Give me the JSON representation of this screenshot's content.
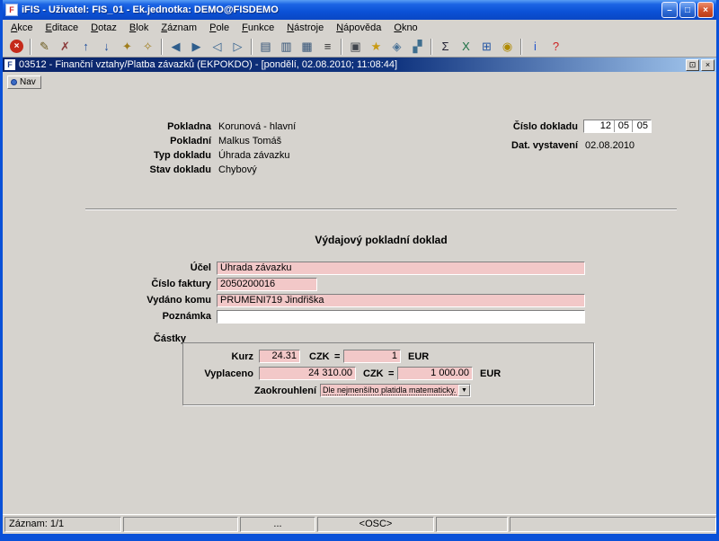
{
  "window": {
    "title": "iFIS - Uživatel: FIS_01 - Ek.jednotka: DEMO@FISDEMO",
    "app_icon_letter": "F",
    "controls": {
      "minimize": "–",
      "maximize": "□",
      "close": "×"
    }
  },
  "menu": {
    "items": [
      "Akce",
      "Editace",
      "Dotaz",
      "Blok",
      "Záznam",
      "Pole",
      "Funkce",
      "Nástroje",
      "Nápověda",
      "Okno"
    ]
  },
  "toolbar": {
    "buttons": [
      {
        "name": "exit",
        "glyph": "×",
        "fg": "#ffffff",
        "exit": true
      },
      {
        "sep": true
      },
      {
        "name": "edit-record",
        "glyph": "✎",
        "fg": "#6B5B1E"
      },
      {
        "name": "clear-record",
        "glyph": "✗",
        "fg": "#8B3A3A"
      },
      {
        "name": "scroll-up",
        "glyph": "↑",
        "fg": "#1F4E9C"
      },
      {
        "name": "scroll-down",
        "glyph": "↓",
        "fg": "#1F4E9C"
      },
      {
        "name": "key",
        "glyph": "✦",
        "fg": "#A07D1C"
      },
      {
        "name": "list-of-values",
        "glyph": "✧",
        "fg": "#A07D1C"
      },
      {
        "sep": true
      },
      {
        "name": "previous-block",
        "glyph": "◀",
        "fg": "#2F5E8C"
      },
      {
        "name": "next-block",
        "glyph": "▶",
        "fg": "#2F5E8C"
      },
      {
        "name": "previous-record",
        "glyph": "◁",
        "fg": "#2F5E8C"
      },
      {
        "name": "next-record",
        "glyph": "▷",
        "fg": "#2F5E8C"
      },
      {
        "sep": true
      },
      {
        "name": "record-list",
        "glyph": "▤",
        "fg": "#2F4F74"
      },
      {
        "name": "multi-record-view",
        "glyph": "▥",
        "fg": "#2F4F74"
      },
      {
        "name": "overview",
        "glyph": "▦",
        "fg": "#2F4F74"
      },
      {
        "name": "row-menu",
        "glyph": "≡",
        "fg": "#333333"
      },
      {
        "sep": true
      },
      {
        "name": "print",
        "glyph": "▣",
        "fg": "#40454D"
      },
      {
        "name": "favorites",
        "glyph": "★",
        "fg": "#C99A12"
      },
      {
        "name": "attachments",
        "glyph": "◈",
        "fg": "#4A7296"
      },
      {
        "name": "chart",
        "glyph": "▞",
        "fg": "#3E6E8E"
      },
      {
        "sep": true
      },
      {
        "name": "sum",
        "glyph": "Σ",
        "fg": "#222233"
      },
      {
        "name": "export-excel",
        "glyph": "X",
        "fg": "#1E7145"
      },
      {
        "name": "window-grid",
        "glyph": "⊞",
        "fg": "#2456A4"
      },
      {
        "name": "lock",
        "glyph": "◉",
        "fg": "#B08A00"
      },
      {
        "sep": true
      },
      {
        "name": "info",
        "glyph": "i",
        "fg": "#2255CC"
      },
      {
        "name": "help",
        "glyph": "?",
        "fg": "#CC2222"
      }
    ]
  },
  "mdi": {
    "title": "03512 - Finanční vztahy/Platba závazků (EKPOKDO) - [pondělí, 02.08.2010; 11:08:44]",
    "icon_letter": "F",
    "controls": {
      "restore": "⊡",
      "close": "×"
    }
  },
  "nav": {
    "label": "Nav"
  },
  "header": {
    "rows": [
      {
        "label": "Pokladna",
        "value": "Korunová - hlavní"
      },
      {
        "label": "Pokladní",
        "value": "Malkus Tomáš"
      },
      {
        "label": "Typ dokladu",
        "value": "Úhrada závazku"
      },
      {
        "label": "Stav dokladu",
        "value": "Chybový"
      }
    ],
    "doc_number": {
      "label": "Číslo dokladu",
      "parts": [
        "12",
        "05",
        "05"
      ]
    },
    "date_issued": {
      "label": "Dat. vystavení",
      "value": "02.08.2010"
    }
  },
  "form": {
    "title": "Výdajový pokladní doklad",
    "fields": [
      {
        "label": "Účel",
        "value": "Úhrada závazku"
      },
      {
        "label": "Číslo faktury",
        "value": "2050200016"
      },
      {
        "label": "Vydáno komu",
        "value": "PRUMENI719 Jindřiška"
      },
      {
        "label": "Poznámka",
        "value": ""
      }
    ],
    "amounts": {
      "label": "Částky",
      "rows": [
        {
          "label": "Kurz",
          "amount_czk": "24.31",
          "currency_left": "CZK",
          "equals": "=",
          "amount_eur": "1",
          "currency_right": "EUR"
        },
        {
          "label": "Vyplaceno",
          "amount_czk": "24 310.00",
          "currency_left": "CZK",
          "equals": "=",
          "amount_eur": "1 000.00",
          "currency_right": "EUR"
        }
      ],
      "rounding": {
        "label": "Zaokrouhlení",
        "value": "Dle nejmenšího platidla matematicky...",
        "arrow_glyph": "▼"
      }
    }
  },
  "statusbar": {
    "panels": [
      "Záznam: 1/1",
      "",
      "...",
      "<OSC>",
      "",
      ""
    ]
  },
  "colors": {
    "field_pink": "#F2C8C8",
    "titlebar_blue": "#0B51D6",
    "mdi_navy": "#0A246A",
    "chrome_gray": "#D6D3CE"
  }
}
